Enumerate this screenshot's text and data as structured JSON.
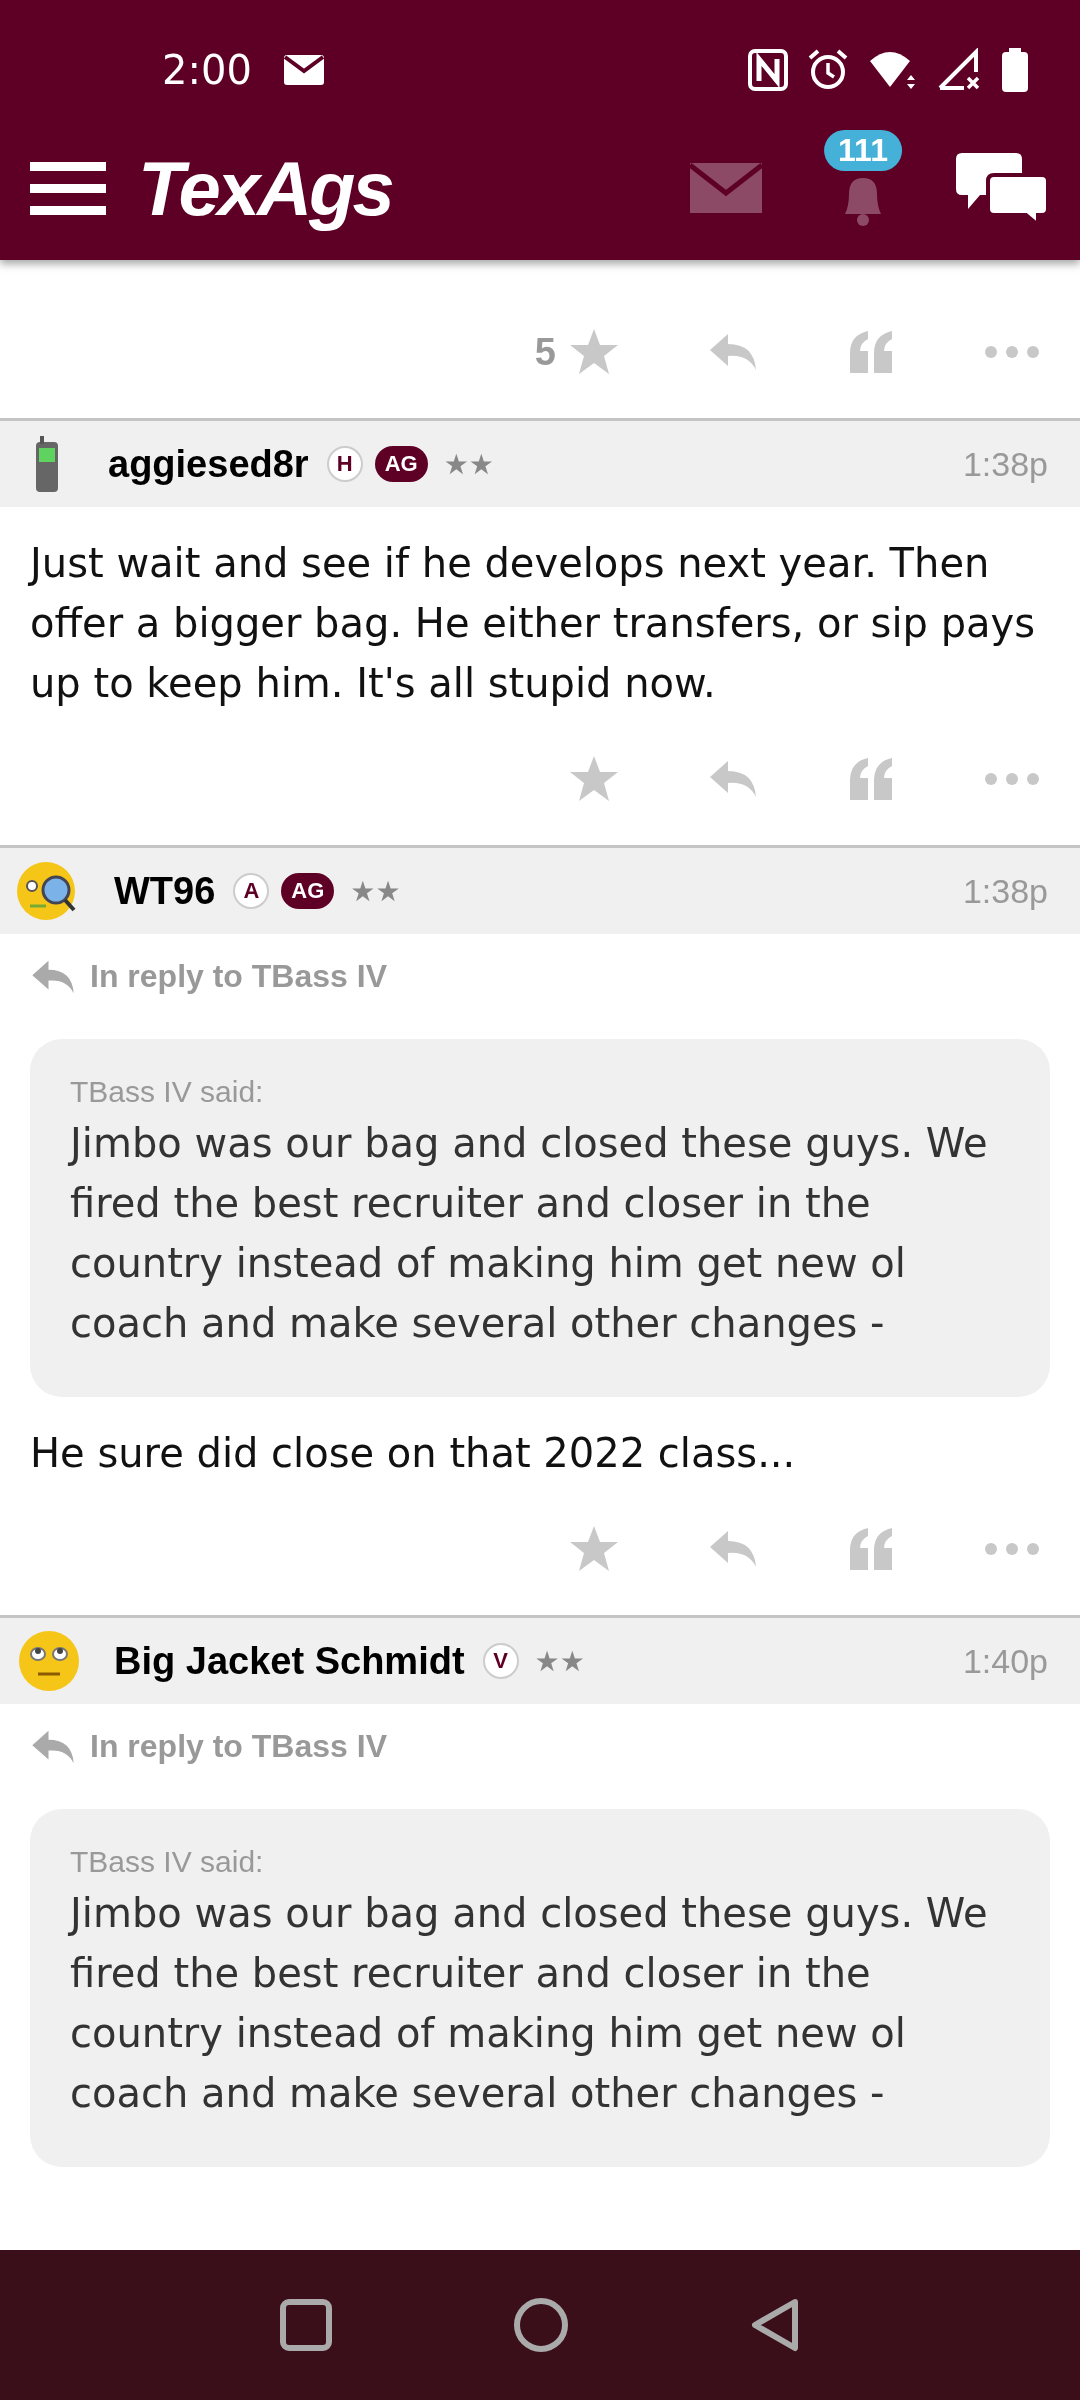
{
  "status_bar": {
    "time": "2:00"
  },
  "app_bar": {
    "logo": "TexAgs",
    "notification_count": "111"
  },
  "previous_post": {
    "rating_count": "5"
  },
  "posts": [
    {
      "author": "aggiesed8r",
      "avatar": {
        "kind": "phone"
      },
      "badges": [
        {
          "label": "H",
          "kind": "outline"
        },
        {
          "label": "AG",
          "kind": "filled"
        }
      ],
      "rank_stars": "★★",
      "time": "1:38p",
      "body": "Just wait and see if he develops next year. Then offer a bigger bag. He either transfers, or sip pays up to keep him. It's all stupid now.",
      "show_actions": true
    },
    {
      "author": "WT96",
      "avatar": {
        "kind": "magnifier"
      },
      "badges": [
        {
          "label": "A",
          "kind": "outline"
        },
        {
          "label": "AG",
          "kind": "filled"
        }
      ],
      "rank_stars": "★★",
      "time": "1:38p",
      "reply_to": "In reply to TBass IV",
      "quote": {
        "said": "TBass IV said:",
        "text": "Jimbo was our bag and closed these guys. We fired the best recruiter and closer in the country instead of making him get new ol coach and make several other changes -"
      },
      "body": "He sure did close on that 2022 class...",
      "show_actions": true
    },
    {
      "author": "Big Jacket Schmidt",
      "avatar": {
        "kind": "eyeroll"
      },
      "badges": [
        {
          "label": "V",
          "kind": "outline"
        }
      ],
      "rank_stars": "★★",
      "time": "1:40p",
      "reply_to": "In reply to TBass IV",
      "quote": {
        "said": "TBass IV said:",
        "text": "Jimbo was our bag and closed these guys. We fired the best recruiter and closer in the country instead of making him get new ol coach and make several other changes -"
      },
      "show_actions": false
    }
  ]
}
